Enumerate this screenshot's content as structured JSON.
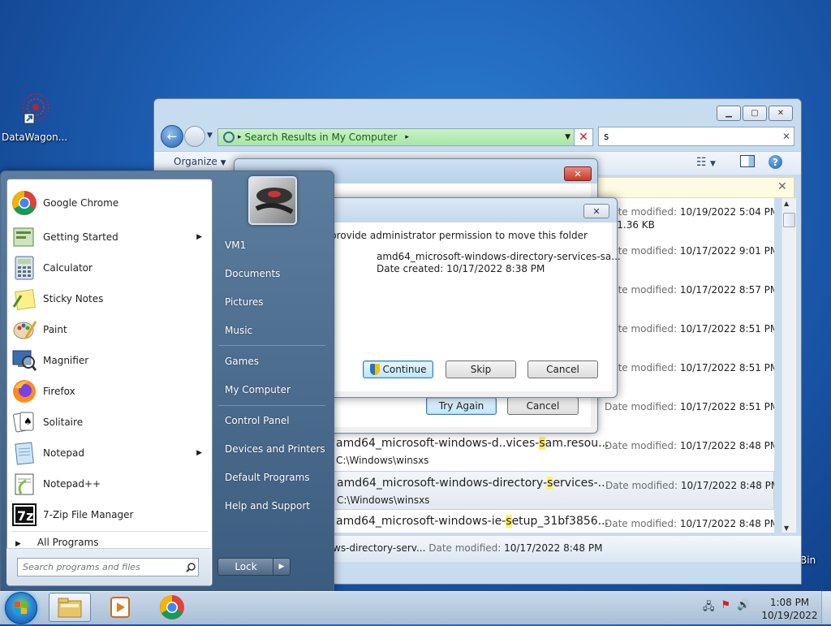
{
  "desktop": {
    "icon_label": "DataWagon...",
    "recycle_label": "Bin"
  },
  "explorer": {
    "address": "Search Results in My Computer",
    "search_value": "s",
    "organize": "Organize",
    "results": [
      {
        "name": "",
        "path": "",
        "date_key": "Date modified:",
        "date": "10/19/2022 5:04 PM",
        "size_key": "Size:",
        "size": "1.36 KB"
      },
      {
        "name": "",
        "path": "",
        "date_key": "Date modified:",
        "date": "10/17/2022 9:01 PM"
      },
      {
        "name": "",
        "path": "",
        "date_key": "Date modified:",
        "date": "10/17/2022 8:57 PM"
      },
      {
        "name": "",
        "path": "",
        "date_key": "Date modified:",
        "date": "10/17/2022 8:51 PM"
      },
      {
        "name": "",
        "path": "",
        "date_key": "Date modified:",
        "date": "10/17/2022 8:51 PM"
      },
      {
        "name": "",
        "path": "",
        "date_key": "Date modified:",
        "date": "10/17/2022 8:51 PM"
      },
      {
        "name_a": "amd64_microsoft-windows-d..vices-",
        "name_hl": "s",
        "name_b": "am.resou...",
        "path": "C:\\Windows\\winsxs",
        "date_key": "Date modified:",
        "date": "10/17/2022 8:48 PM"
      },
      {
        "name_a": "amd64_microsoft-windows-directory-",
        "name_hl": "s",
        "name_b": "ervices-...",
        "path": "C:\\Windows\\winsxs",
        "date_key": "Date modified:",
        "date": "10/17/2022 8:48 PM"
      },
      {
        "name_a": "amd64_microsoft-windows-ie-",
        "name_hl": "s",
        "name_b": "etup_31bf3856...",
        "path": "",
        "date_key": "Date modified:",
        "date": "10/17/2022 8:48 PM"
      }
    ],
    "details": {
      "name": "ws-directory-serv...",
      "date_key": "Date modified:",
      "date": "10/17/2022 8:48 PM"
    }
  },
  "dialog_back": {
    "try_again": "Try Again",
    "cancel": "Cancel"
  },
  "dialog_front": {
    "message": "provide administrator permission to move this folder",
    "item_name": "amd64_microsoft-windows-directory-services-sa...",
    "item_date": "Date created: 10/17/2022 8:38 PM",
    "continue": "Continue",
    "skip": "Skip",
    "cancel": "Cancel"
  },
  "start_menu": {
    "programs": [
      {
        "label": "Google Chrome",
        "icon": "chrome-icon"
      },
      {
        "label": "Getting Started",
        "icon": "getting-started-icon",
        "submenu": true
      },
      {
        "label": "Calculator",
        "icon": "calculator-icon"
      },
      {
        "label": "Sticky Notes",
        "icon": "sticky-notes-icon"
      },
      {
        "label": "Paint",
        "icon": "paint-icon"
      },
      {
        "label": "Magnifier",
        "icon": "magnifier-icon"
      },
      {
        "label": "Firefox",
        "icon": "firefox-icon"
      },
      {
        "label": "Solitaire",
        "icon": "solitaire-icon"
      },
      {
        "label": "Notepad",
        "icon": "notepad-icon",
        "submenu": true
      },
      {
        "label": "Notepad++",
        "icon": "notepad-plus-plus-icon"
      },
      {
        "label": "7-Zip File Manager",
        "icon": "7zip-icon"
      }
    ],
    "all_programs": "All Programs",
    "search_placeholder": "Search programs and files",
    "right": [
      "VM1",
      "Documents",
      "Pictures",
      "Music",
      "Games",
      "My Computer",
      "Control Panel",
      "Devices and Printers",
      "Default Programs",
      "Help and Support"
    ],
    "lock": "Lock"
  },
  "taskbar": {
    "time": "1:08 PM",
    "date": "10/19/2022"
  }
}
